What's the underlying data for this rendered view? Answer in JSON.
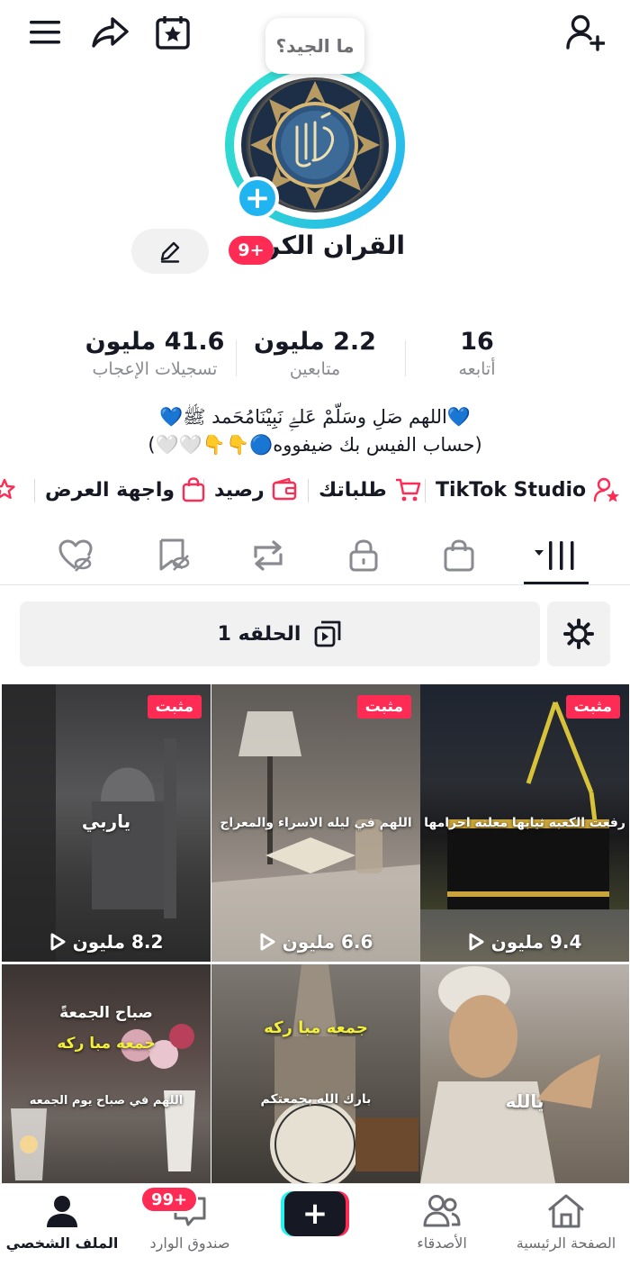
{
  "top_bar": {
    "bubble_text": "ما الجيد؟"
  },
  "profile": {
    "name": "القران الكريم",
    "name_badge": "9+",
    "avatar_plus": "+"
  },
  "stats": [
    {
      "value": "16",
      "label": "أتابعه"
    },
    {
      "value": "2.2 مليون",
      "label": "متابعين"
    },
    {
      "value": "41.6 مليون",
      "label": "تسجيلات الإعجاب"
    }
  ],
  "bio": {
    "line1": "💙اللهم صَلِ وسَلّمْ عَلۓِ نَبِيْنَامُحَمد ﷺ💙",
    "line2": "(حساب الفيس بك ضيفووه🔵👇👇🤍🤍)"
  },
  "shortcuts": [
    {
      "label": "TikTok Studio",
      "icon": "person-star-icon"
    },
    {
      "label": "طلباتك",
      "icon": "cart-icon"
    },
    {
      "label": "رصيد",
      "icon": "wallet-icon"
    },
    {
      "label": "واجهة العرض",
      "icon": "shopping-bag-icon"
    }
  ],
  "playlist": {
    "label": "الحلقه 1"
  },
  "videos": [
    {
      "pinned": "مثبت",
      "caption": "رفعت الكعبه ثيابها معلنه احرامها",
      "views": "9.4 مليون"
    },
    {
      "pinned": "مثبت",
      "caption": "اللهم في ليله الاسراء والمعراج",
      "views": "6.6 مليون"
    },
    {
      "pinned": "مثبت",
      "caption": "ياربي",
      "views": "8.2 مليون"
    },
    {
      "caption": "يالله"
    },
    {
      "caption_top": "جمعه مبا ركه",
      "caption": "بارك الله بجمعتكم"
    },
    {
      "caption_top": "صباح الجمعةً",
      "caption_mid": "جمعه مبا ركه",
      "caption": "اللهم في صباح يوم الجمعه"
    }
  ],
  "bottom_nav": {
    "home": "الصفحة الرئيسية",
    "friends": "الأصدقاء",
    "create": "+",
    "inbox": "صندوق الوارد",
    "inbox_badge": "99+",
    "profile": "الملف الشخصي"
  },
  "colors": {
    "accent": "#fe2c55",
    "avatar_ring": "#25b3f0",
    "text": "#161823",
    "muted": "#8a8b91"
  }
}
